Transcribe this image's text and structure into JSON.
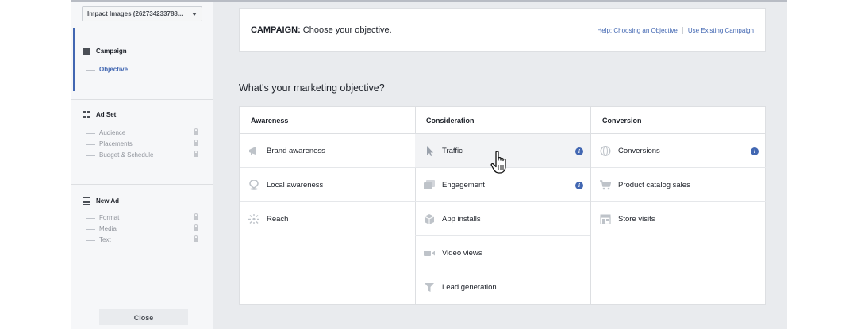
{
  "sidebar": {
    "account_select": "Impact Images (262734233788...",
    "campaign": {
      "title": "Campaign",
      "items": [
        {
          "label": "Objective",
          "active": true
        }
      ]
    },
    "ad_set": {
      "title": "Ad Set",
      "items": [
        {
          "label": "Audience"
        },
        {
          "label": "Placements"
        },
        {
          "label": "Budget & Schedule"
        }
      ]
    },
    "new_ad": {
      "title": "New Ad",
      "items": [
        {
          "label": "Format"
        },
        {
          "label": "Media"
        },
        {
          "label": "Text"
        }
      ]
    },
    "close_label": "Close"
  },
  "header": {
    "title_bold": "CAMPAIGN:",
    "title_rest": " Choose your objective.",
    "help_link": "Help: Choosing an Objective",
    "existing_link": "Use Existing Campaign"
  },
  "question": "What's your marketing objective?",
  "columns": [
    {
      "heading": "Awareness",
      "options": [
        {
          "label": "Brand awareness",
          "icon": "megaphone-icon"
        },
        {
          "label": "Local awareness",
          "icon": "location-pin-icon"
        },
        {
          "label": "Reach",
          "icon": "reach-burst-icon"
        }
      ]
    },
    {
      "heading": "Consideration",
      "options": [
        {
          "label": "Traffic",
          "icon": "cursor-arrow-icon",
          "info": true,
          "hovered": true
        },
        {
          "label": "Engagement",
          "icon": "engagement-icon",
          "info": true
        },
        {
          "label": "App installs",
          "icon": "box-icon"
        },
        {
          "label": "Video views",
          "icon": "video-camera-icon"
        },
        {
          "label": "Lead generation",
          "icon": "funnel-icon"
        }
      ]
    },
    {
      "heading": "Conversion",
      "options": [
        {
          "label": "Conversions",
          "icon": "globe-icon",
          "info": true
        },
        {
          "label": "Product catalog sales",
          "icon": "shopping-cart-icon"
        },
        {
          "label": "Store visits",
          "icon": "store-icon"
        }
      ]
    }
  ],
  "colors": {
    "accent": "#4267b2",
    "background": "#e9ebee",
    "icon_gray": "#bec3c9"
  }
}
